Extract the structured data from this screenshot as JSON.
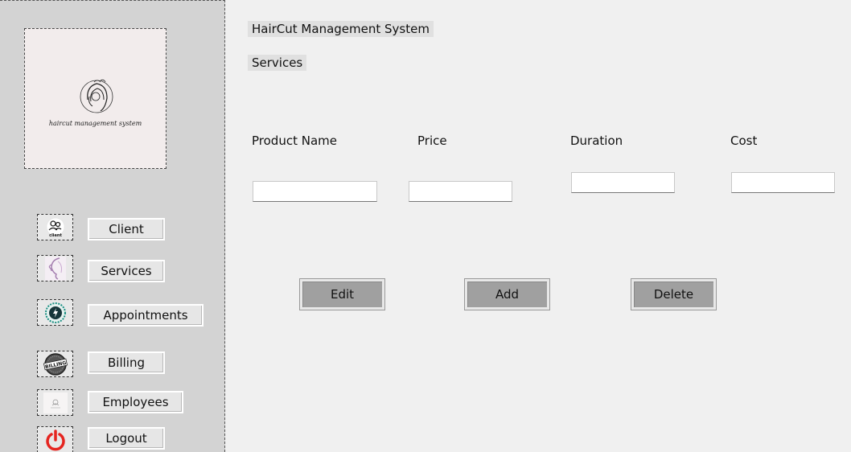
{
  "sidebar": {
    "logo_text": "haircut management system",
    "items": [
      {
        "label": "Client",
        "icon": "client-icon"
      },
      {
        "label": "Services",
        "icon": "services-icon"
      },
      {
        "label": "Appointments",
        "icon": "appointments-icon"
      },
      {
        "label": "Billing",
        "icon": "billing-icon"
      },
      {
        "label": "Employees",
        "icon": "employees-icon"
      },
      {
        "label": "Logout",
        "icon": "power-icon"
      }
    ],
    "client_icon_text": "client",
    "billing_icon_text": "BILLING"
  },
  "header": {
    "app_title": "HairCut Management System",
    "page_title": "Services"
  },
  "form": {
    "labels": {
      "product_name": "Product Name",
      "price": "Price",
      "duration": "Duration",
      "cost": "Cost"
    },
    "values": {
      "product_name": "",
      "price": "",
      "duration": "",
      "cost": ""
    }
  },
  "actions": {
    "edit": "Edit",
    "add": "Add",
    "delete": "Delete"
  },
  "colors": {
    "sidebar_bg": "#d3d3d3",
    "main_bg": "#f0f0f0",
    "action_button": "#a0a0a0",
    "logout_red": "#e52520"
  }
}
